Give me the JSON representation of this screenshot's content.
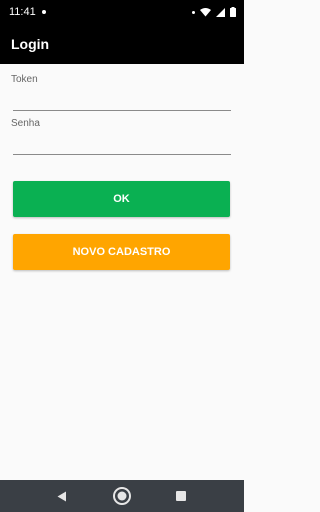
{
  "status_bar": {
    "time": "11:41"
  },
  "app_bar": {
    "title": "Login"
  },
  "form": {
    "token_label": "Token",
    "token_value": "",
    "senha_label": "Senha",
    "senha_value": ""
  },
  "buttons": {
    "ok_label": "OK",
    "ok_color": "#0ab052",
    "novo_cadastro_label": "NOVO CADASTRO",
    "novo_cadastro_color": "#ffa500"
  },
  "nav_bar": {
    "icons": [
      "back-icon",
      "home-icon",
      "recents-icon"
    ]
  }
}
